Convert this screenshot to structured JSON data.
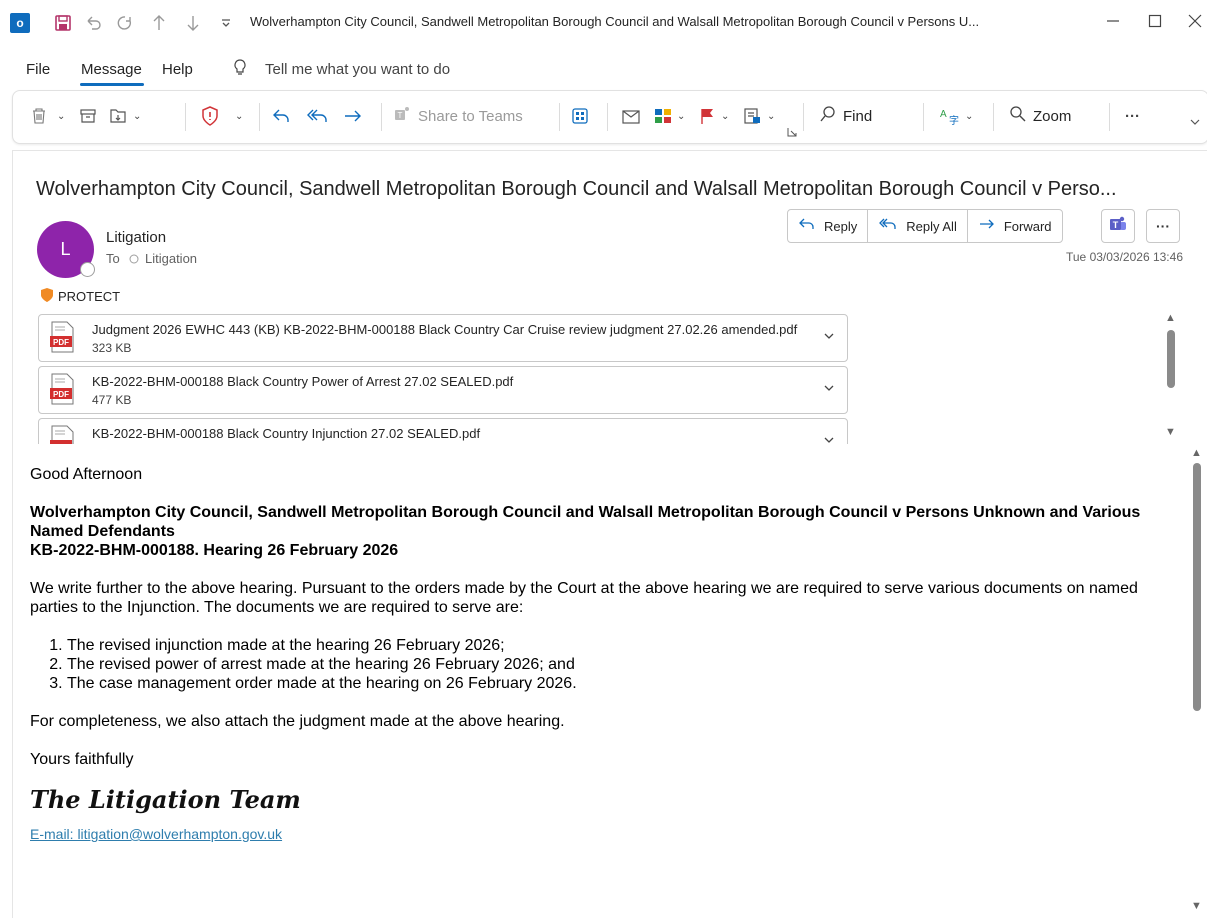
{
  "window": {
    "title": "Wolverhampton City Council, Sandwell Metropolitan Borough Council and Walsall Metropolitan Borough Council v Persons U...",
    "app_icon_letter": "o"
  },
  "menu": {
    "items": [
      "File",
      "Message",
      "Help"
    ],
    "tell_me": "Tell me what you want to do"
  },
  "ribbon": {
    "share_to_teams": "Share to Teams",
    "find": "Find",
    "zoom": "Zoom",
    "more": "···"
  },
  "message": {
    "subject": "Wolverhampton City Council, Sandwell Metropolitan Borough Council and Walsall Metropolitan Borough Council v Perso...",
    "avatar_letter": "L",
    "sender": "Litigation",
    "to_label": "To",
    "to_recipient": "Litigation",
    "date": "Tue 03/03/2026 13:46",
    "classification": "PROTECT",
    "actions": {
      "reply": "Reply",
      "reply_all": "Reply All",
      "forward": "Forward",
      "more": "···"
    }
  },
  "attachments": [
    {
      "name": "Judgment 2026 EWHC 443 (KB) KB-2022-BHM-000188 Black Country Car Cruise review judgment 27.02.26 amended.pdf",
      "size": "323 KB",
      "type": "PDF"
    },
    {
      "name": "KB-2022-BHM-000188 Black Country Power of Arrest 27.02 SEALED.pdf",
      "size": "477 KB",
      "type": "PDF"
    },
    {
      "name": "KB-2022-BHM-000188 Black Country Injunction 27.02 SEALED.pdf",
      "size": "",
      "type": "PDF"
    }
  ],
  "body": {
    "greeting": "Good Afternoon",
    "heading_line1": "Wolverhampton City Council, Sandwell Metropolitan Borough Council and Walsall Metropolitan Borough Council v Persons Unknown and Various Named Defendants",
    "heading_line2": "KB-2022-BHM-000188. Hearing 26 February 2026",
    "para1": "We write further to the above hearing.  Pursuant to the orders made by the Court at the above hearing we are required to serve various documents on named parties to the Injunction. The documents we are required to serve are:",
    "list": [
      "The revised injunction made at the hearing 26 February 2026;",
      "The revised power of arrest made at the hearing 26 February 2026; and",
      "The case management order made at the hearing on 26 February 2026."
    ],
    "para2": "For completeness, we also attach the judgment made at the above hearing.",
    "closing": "Yours faithfully",
    "signature": "The Litigation Team",
    "email_line": "E-mail: litigation@wolverhampton.gov.uk"
  },
  "colors": {
    "accent": "#0f6cbd",
    "avatar": "#8e24aa",
    "pdf_red": "#d32f2f",
    "shield": "#f08a24",
    "teams": "#5b5fc7",
    "flag": "#d13438"
  }
}
